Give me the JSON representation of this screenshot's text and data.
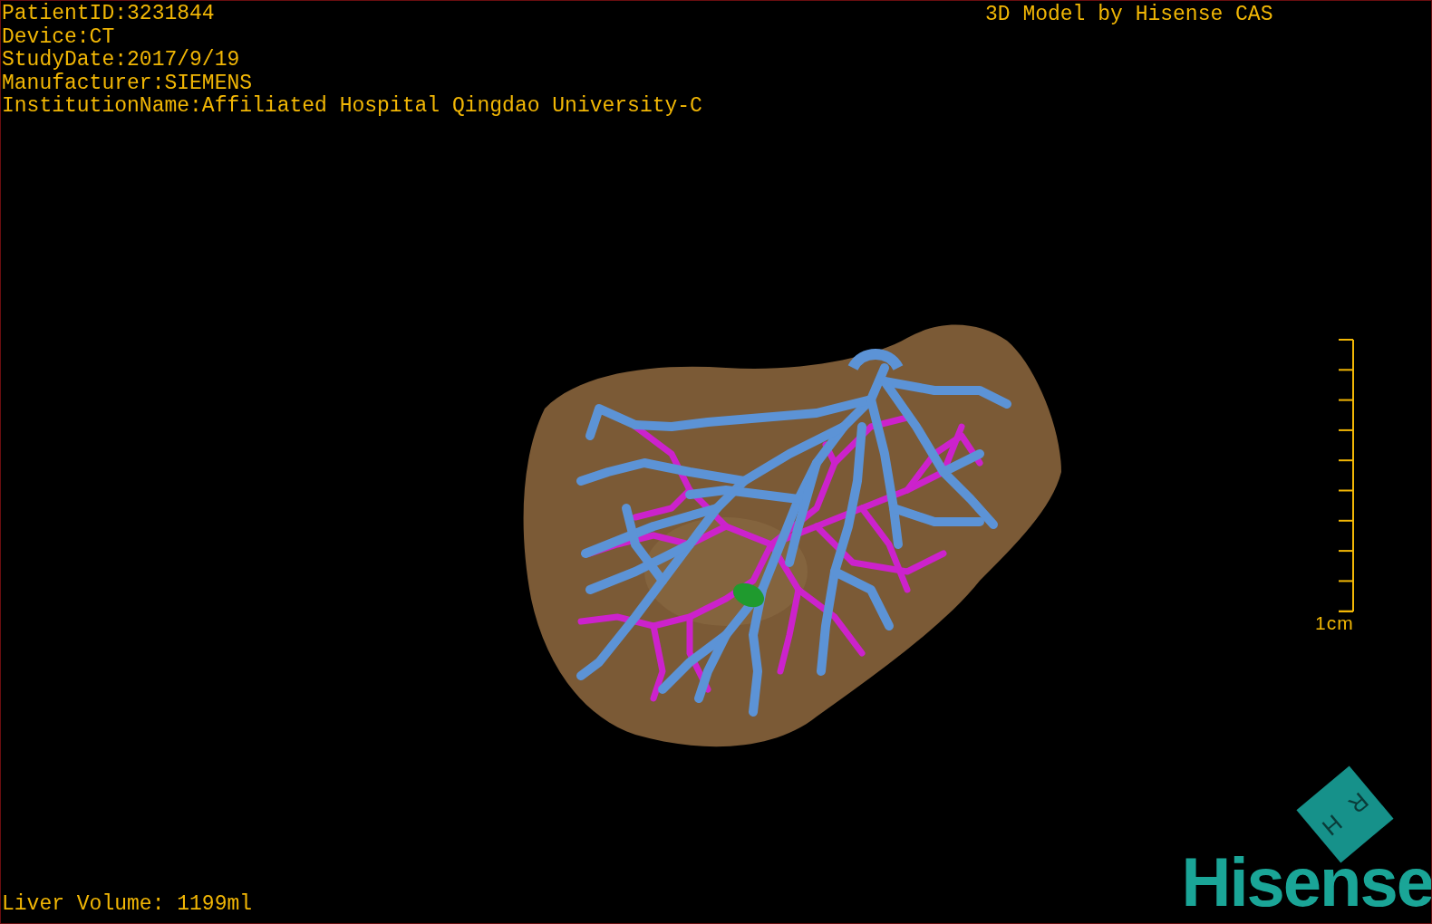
{
  "patient_info": [
    "PatientID:3231844",
    "Device:CT",
    "StudyDate:2017/9/19",
    "Manufacturer:SIEMENS",
    "InstitutionName:Affiliated Hospital Qingdao University-C"
  ],
  "title": "3D Model by Hisense CAS",
  "scale_bar": {
    "label": "1cm"
  },
  "orientation_cube": {
    "labels": [
      "H",
      "R"
    ]
  },
  "liver_volume": "Liver Volume: 1199ml",
  "logo": "Hisense"
}
